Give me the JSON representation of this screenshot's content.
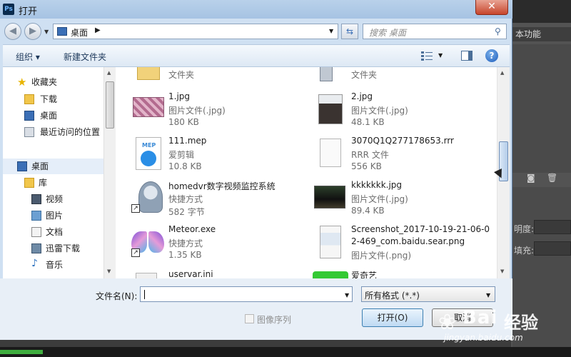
{
  "dialog": {
    "title": "打开",
    "app_icon": "Ps",
    "close_glyph": "✕"
  },
  "address": {
    "location": "桌面",
    "search_placeholder": "搜索 桌面"
  },
  "toolbar": {
    "organize": "组织 ▾",
    "new_folder": "新建文件夹"
  },
  "nav": {
    "favorites": "收藏夹",
    "downloads": "下载",
    "desktop_fav": "桌面",
    "recent": "最近访问的位置",
    "desktop": "桌面",
    "library": "库",
    "videos": "视频",
    "pictures": "图片",
    "documents": "文档",
    "xunlei": "迅雷下载",
    "music": "音乐"
  },
  "files": {
    "folder_a": {
      "type": "文件夹"
    },
    "folder_b": {
      "type": "文件夹"
    },
    "f1": {
      "name": "1.jpg",
      "type": "图片文件(.jpg)",
      "size": "180 KB"
    },
    "f2": {
      "name": "2.jpg",
      "type": "图片文件(.jpg)",
      "size": "48.1 KB"
    },
    "f3": {
      "name": "111.mep",
      "type": "爱剪辑",
      "size": "10.8 KB",
      "badge": "MEP"
    },
    "f4": {
      "name": "3070Q1Q277178653.rrr",
      "type": "RRR 文件",
      "size": "556 KB"
    },
    "f5": {
      "name": "homedvr数字视频监控系统",
      "type": "快捷方式",
      "size": "582 字节"
    },
    "f6": {
      "name": "kkkkkkk.jpg",
      "type": "图片文件(.jpg)",
      "size": "89.4 KB"
    },
    "f7": {
      "name": "Meteor.exe",
      "type": "快捷方式",
      "size": "1.35 KB"
    },
    "f8": {
      "name_line1": "Screenshot_2017-10-19-21-06-0",
      "name_line2": "2-469_com.baidu.sear.png",
      "type": "图片文件(.png)"
    },
    "f9": {
      "name": "uservar.ini"
    },
    "f10": {
      "name": "爱奇艺"
    }
  },
  "bottom": {
    "filename_label": "文件名(N):",
    "filename_value": "",
    "filter": "所有格式 (*.*)",
    "image_sequence": "图像序列",
    "open": "打开(O)",
    "cancel": "取消"
  },
  "photoshop": {
    "workspace": "本功能",
    "opacity_label": "明度:",
    "fill_label": "填充:"
  },
  "watermark": {
    "brand": "Bai",
    "cn": "经验",
    "url": "jingyan.baidu.com"
  }
}
